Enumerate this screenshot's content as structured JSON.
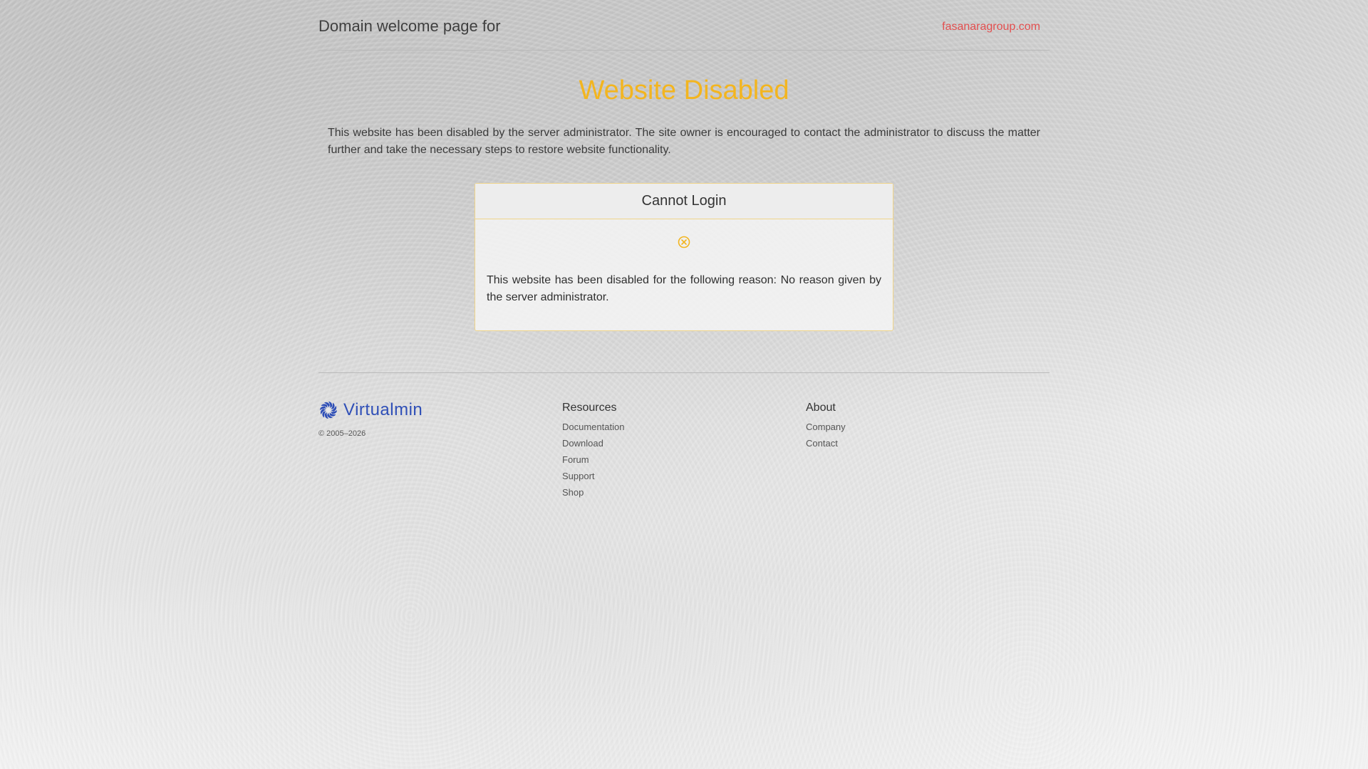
{
  "header": {
    "title": "Domain welcome page for",
    "domain": "fasanaragroup.com"
  },
  "main": {
    "title": "Website Disabled",
    "intro": "This website has been disabled by the server administrator. The site owner is encouraged to contact the administrator to discuss the matter further and take the necessary steps to restore website functionality."
  },
  "card": {
    "title": "Cannot Login",
    "icon": "circle-x-icon",
    "message": "This website has been disabled for the following reason: No reason given by the server administrator."
  },
  "footer": {
    "brand": "Virtualmin",
    "copyright": "© 2005–2026",
    "resources": {
      "heading": "Resources",
      "links": [
        "Documentation",
        "Download",
        "Forum",
        "Support",
        "Shop"
      ]
    },
    "about": {
      "heading": "About",
      "links": [
        "Company",
        "Contact"
      ]
    }
  },
  "colors": {
    "accent": "#f3b51f",
    "domain_link": "#e34f4f",
    "brand": "#2f4fb7",
    "card_border": "#efd48a"
  }
}
